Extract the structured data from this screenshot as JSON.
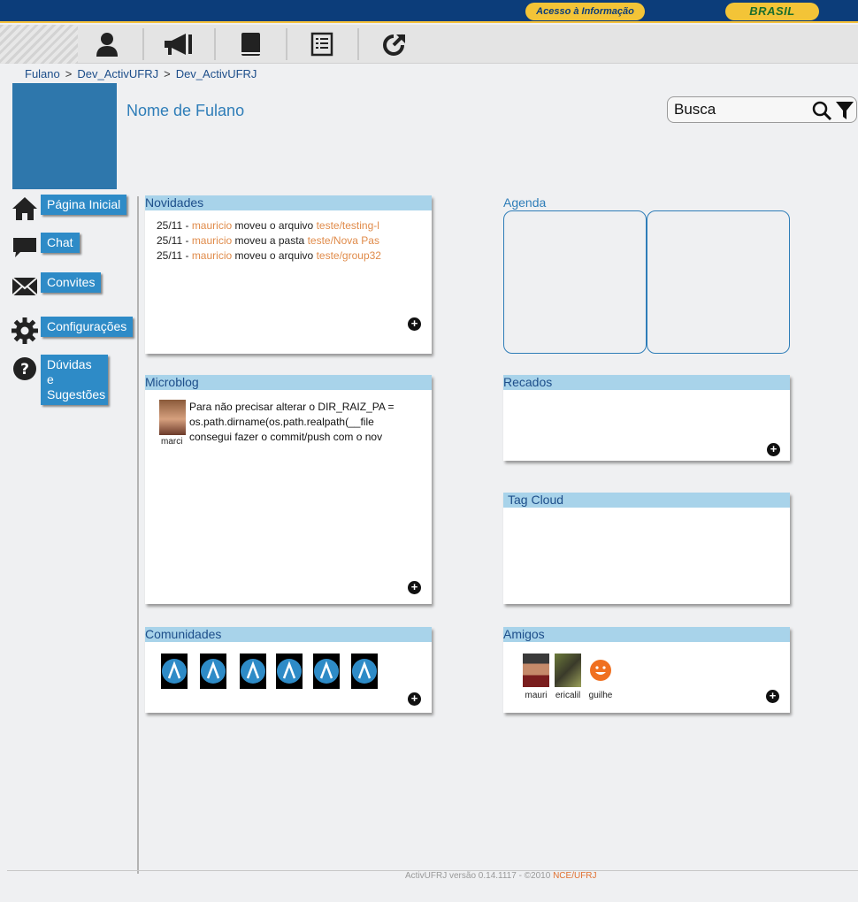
{
  "gov_bar": {
    "acesso_label": "Acesso à Informação",
    "brasil_label": "BRASIL"
  },
  "toolbar": {
    "icons": [
      "user-icon",
      "megaphone-icon",
      "book-icon",
      "list-icon",
      "external-link-icon"
    ]
  },
  "breadcrumb": {
    "items": [
      "Fulano",
      "Dev_ActivUFRJ",
      "Dev_ActivUFRJ"
    ],
    "separator": ">"
  },
  "user": {
    "name": "Nome de Fulano"
  },
  "search": {
    "placeholder": "Busca"
  },
  "sidebar": {
    "items": [
      {
        "label": "Página Inicial",
        "icon": "home-icon"
      },
      {
        "label": "Chat",
        "icon": "chat-icon"
      },
      {
        "label": "Convites",
        "icon": "envelope-icon"
      },
      {
        "label": "Configurações",
        "icon": "gear-icon"
      },
      {
        "label": "Dúvidas e Sugestões",
        "icon": "help-icon"
      }
    ]
  },
  "novidades": {
    "title": "Novidades",
    "items": [
      {
        "date": "25/11 -",
        "user": "mauricio",
        "action": "moveu o arquivo",
        "target": "teste/testing-l"
      },
      {
        "date": "25/11 -",
        "user": "mauricio",
        "action": "moveu a pasta",
        "target": "teste/Nova Pas"
      },
      {
        "date": "25/11 -",
        "user": "mauricio",
        "action": "moveu o arquivo",
        "target": "teste/group32"
      }
    ]
  },
  "microblog": {
    "title": "Microblog",
    "posts": [
      {
        "user": "marci",
        "text": "Para não precisar alterar o DIR_RAIZ_PA = os.path.dirname(os.path.realpath(__file consegui fazer o commit/push com o nov"
      }
    ]
  },
  "comunidades": {
    "title": "Comunidades",
    "count": 6
  },
  "agenda": {
    "title": "Agenda"
  },
  "recados": {
    "title": "Recados"
  },
  "tag_cloud": {
    "title": "Tag Cloud"
  },
  "amigos": {
    "title": "Amigos",
    "friends": [
      "mauri",
      "ericalil",
      "guilhe"
    ]
  },
  "footer": {
    "text": "ActivUFRJ versão 0.14.1117 - ©2010",
    "link": "NCE/UFRJ"
  },
  "colors": {
    "gov_blue": "#0c3d7a",
    "gov_yellow": "#f3c437",
    "accent_blue": "#2e8bc7",
    "panel_header": "#a8d3ea",
    "link_orange": "#e08b4a"
  }
}
